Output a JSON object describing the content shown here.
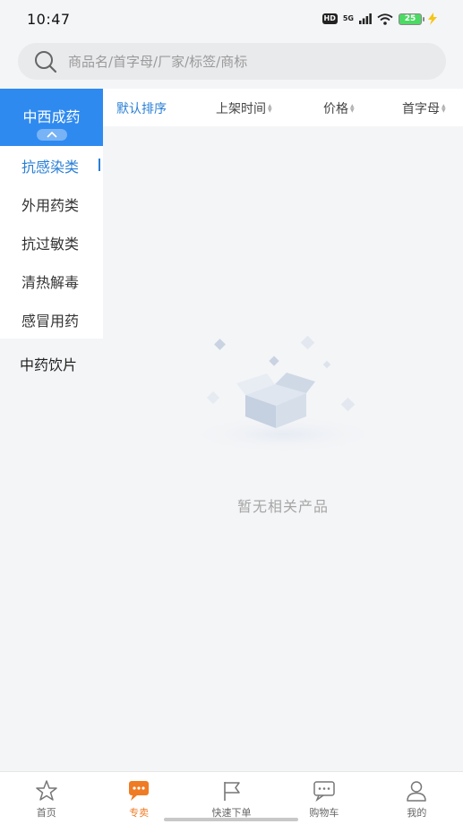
{
  "status_bar": {
    "time": "10:47",
    "hd": "HD",
    "network": "5G",
    "battery": "25"
  },
  "search": {
    "placeholder": "商品名/首字母/厂家/标签/商标"
  },
  "sidebar": {
    "active_category": "中西成药",
    "sub_items": [
      {
        "label": "抗感染类",
        "active": true
      },
      {
        "label": "外用药类",
        "active": false
      },
      {
        "label": "抗过敏类",
        "active": false
      },
      {
        "label": "清热解毒",
        "active": false
      },
      {
        "label": "感冒用药",
        "active": false
      }
    ],
    "other_category": "中药饮片"
  },
  "sort_bar": {
    "default": "默认排序",
    "shelf_time": "上架时间",
    "price": "价格",
    "initial": "首字母"
  },
  "empty_state": {
    "text": "暂无相关产品"
  },
  "tab_bar": {
    "tabs": [
      {
        "label": "首页",
        "icon": "star-icon",
        "active": false
      },
      {
        "label": "专卖",
        "icon": "chat-bubble-icon",
        "active": true
      },
      {
        "label": "快速下单",
        "icon": "flag-icon",
        "active": false
      },
      {
        "label": "购物车",
        "icon": "message-icon",
        "active": false
      },
      {
        "label": "我的",
        "icon": "user-icon",
        "active": false
      }
    ]
  },
  "colors": {
    "primary_blue": "#2f8af0",
    "active_blue": "#2a7fd6",
    "tab_active_orange": "#ef7b24"
  }
}
